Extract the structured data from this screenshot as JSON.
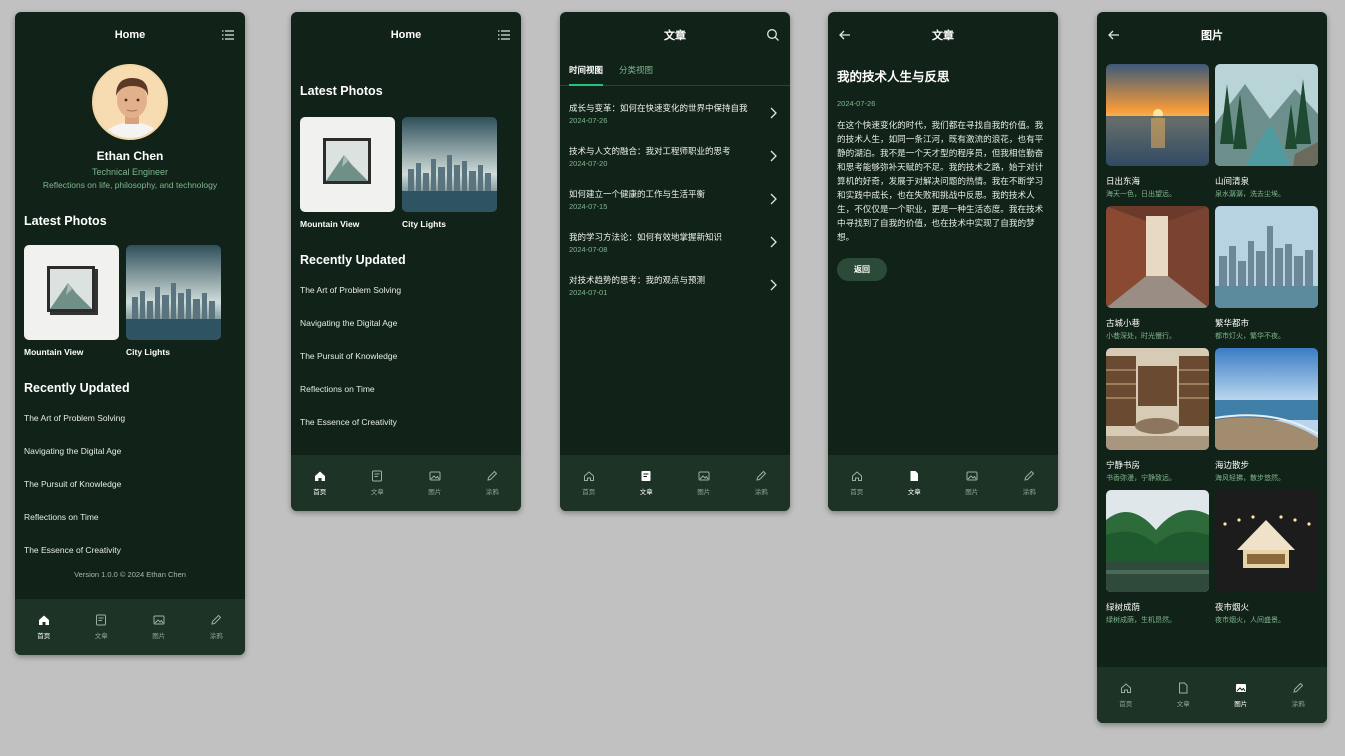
{
  "screen1": {
    "title": "Home",
    "profile": {
      "name": "Ethan Chen",
      "role": "Technical Engineer",
      "bio": "Reflections on life, philosophy, and technology"
    },
    "latest_photos_title": "Latest Photos",
    "photos": [
      {
        "caption": "Mountain View"
      },
      {
        "caption": "City Lights"
      }
    ],
    "recently_updated_title": "Recently Updated",
    "recent": [
      "The Art of Problem Solving",
      "Navigating the Digital Age",
      "The Pursuit of Knowledge",
      "Reflections on Time",
      "The Essence of Creativity"
    ],
    "version": "Version 1.0.0 © 2024 Ethan Chen"
  },
  "screen2": {
    "title": "Home",
    "latest_photos_title": "Latest Photos",
    "photos": [
      {
        "caption": "Mountain View"
      },
      {
        "caption": "City Lights"
      }
    ],
    "recently_updated_title": "Recently Updated",
    "recent": [
      "The Art of Problem Solving",
      "Navigating the Digital Age",
      "The Pursuit of Knowledge",
      "Reflections on Time",
      "The Essence of Creativity"
    ]
  },
  "screen3": {
    "title": "文章",
    "tabs": [
      "时间视图",
      "分类视图"
    ],
    "articles": [
      {
        "title": "成长与变革：如何在快速变化的世界中保持自我",
        "date": "2024-07-26"
      },
      {
        "title": "技术与人文的融合：我对工程师职业的思考",
        "date": "2024-07-20"
      },
      {
        "title": "如何建立一个健康的工作与生活平衡",
        "date": "2024-07-15"
      },
      {
        "title": "我的学习方法论：如何有效地掌握新知识",
        "date": "2024-07-08"
      },
      {
        "title": "对技术趋势的思考：我的观点与预测",
        "date": "2024-07-01"
      }
    ]
  },
  "screen4": {
    "title": "文章",
    "article_title": "我的技术人生与反思",
    "date": "2024-07-26",
    "body": "在这个快速变化的时代，我们都在寻找自我的价值。我的技术人生，如同一条江河，既有激流的浪花，也有平静的湖泊。我不是一个天才型的程序员，但我相信勤奋和思考能够弥补天赋的不足。我的技术之路，始于对计算机的好奇，发展于对解决问题的热情。我在不断学习和实践中成长，也在失败和挑战中反思。我的技术人生，不仅仅是一个职业，更是一种生活态度。我在技术中寻找到了自我的价值，也在技术中实现了自我的梦想。",
    "back_label": "返回"
  },
  "screen5": {
    "title": "图片",
    "items": [
      {
        "title": "日出东海",
        "desc": "海天一色，日出望远。"
      },
      {
        "title": "山间清泉",
        "desc": "泉水潺潺，洗去尘埃。"
      },
      {
        "title": "古城小巷",
        "desc": "小巷深处，时光慢行。"
      },
      {
        "title": "繁华都市",
        "desc": "都市灯火，繁华不夜。"
      },
      {
        "title": "宁静书房",
        "desc": "书香弥漫，宁静致远。"
      },
      {
        "title": "海边散步",
        "desc": "海风轻拂，散步悠然。"
      },
      {
        "title": "绿树成荫",
        "desc": "绿树成荫，生机昂然。"
      },
      {
        "title": "夜市烟火",
        "desc": "夜市烟火，人间盛景。"
      }
    ]
  },
  "tabbar": [
    "首页",
    "文章",
    "图片",
    "涂鸦"
  ],
  "colors": {
    "bg": "#112218",
    "tabbar": "#1d3325",
    "accent": "#27c27a",
    "muted": "#7fb58e"
  }
}
